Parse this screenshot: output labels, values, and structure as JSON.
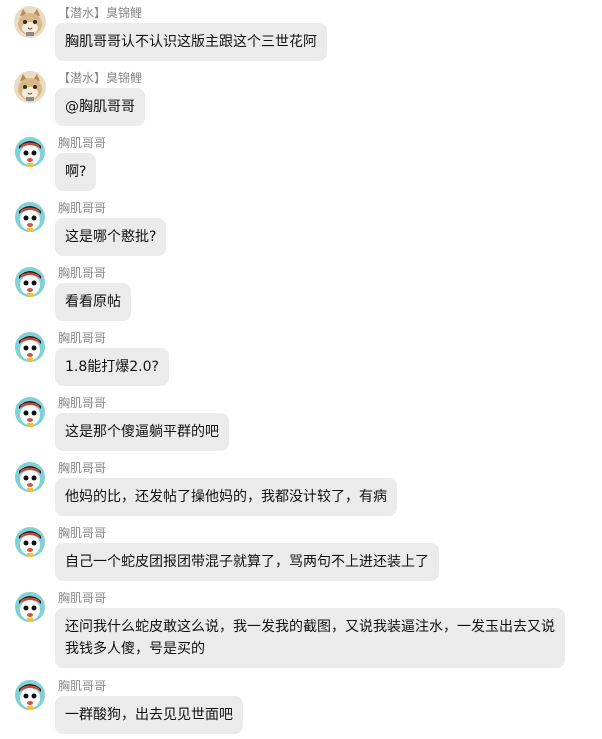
{
  "messages": [
    {
      "sender": "【潜水】臭锦鲤",
      "avatar": "cat-avatar",
      "text": "胸肌哥哥认不认识这版主跟这个三世花阿"
    },
    {
      "sender": "【潜水】臭锦鲤",
      "avatar": "cat-avatar",
      "text": "@胸肌哥哥"
    },
    {
      "sender": "胸肌哥哥",
      "avatar": "cartoon-avatar",
      "text": "啊?"
    },
    {
      "sender": "胸肌哥哥",
      "avatar": "cartoon-avatar",
      "text": "这是哪个憨批?"
    },
    {
      "sender": "胸肌哥哥",
      "avatar": "cartoon-avatar",
      "text": "看看原帖"
    },
    {
      "sender": "胸肌哥哥",
      "avatar": "cartoon-avatar",
      "text": "1.8能打爆2.0?"
    },
    {
      "sender": "胸肌哥哥",
      "avatar": "cartoon-avatar",
      "text": "这是那个傻逼躺平群的吧"
    },
    {
      "sender": "胸肌哥哥",
      "avatar": "cartoon-avatar",
      "text": "他妈的比，还发帖了操他妈的，我都没计较了，有病"
    },
    {
      "sender": "胸肌哥哥",
      "avatar": "cartoon-avatar",
      "text": "自己一个蛇皮团报团带混子就算了，骂两句不上进还装上了"
    },
    {
      "sender": "胸肌哥哥",
      "avatar": "cartoon-avatar",
      "text": "还问我什么蛇皮敢这么说，我一发我的截图，又说我装逼注水，一发玉出去又说我钱多人傻，号是买的"
    },
    {
      "sender": "胸肌哥哥",
      "avatar": "cartoon-avatar",
      "text": "一群酸狗，出去见见世面吧"
    }
  ]
}
